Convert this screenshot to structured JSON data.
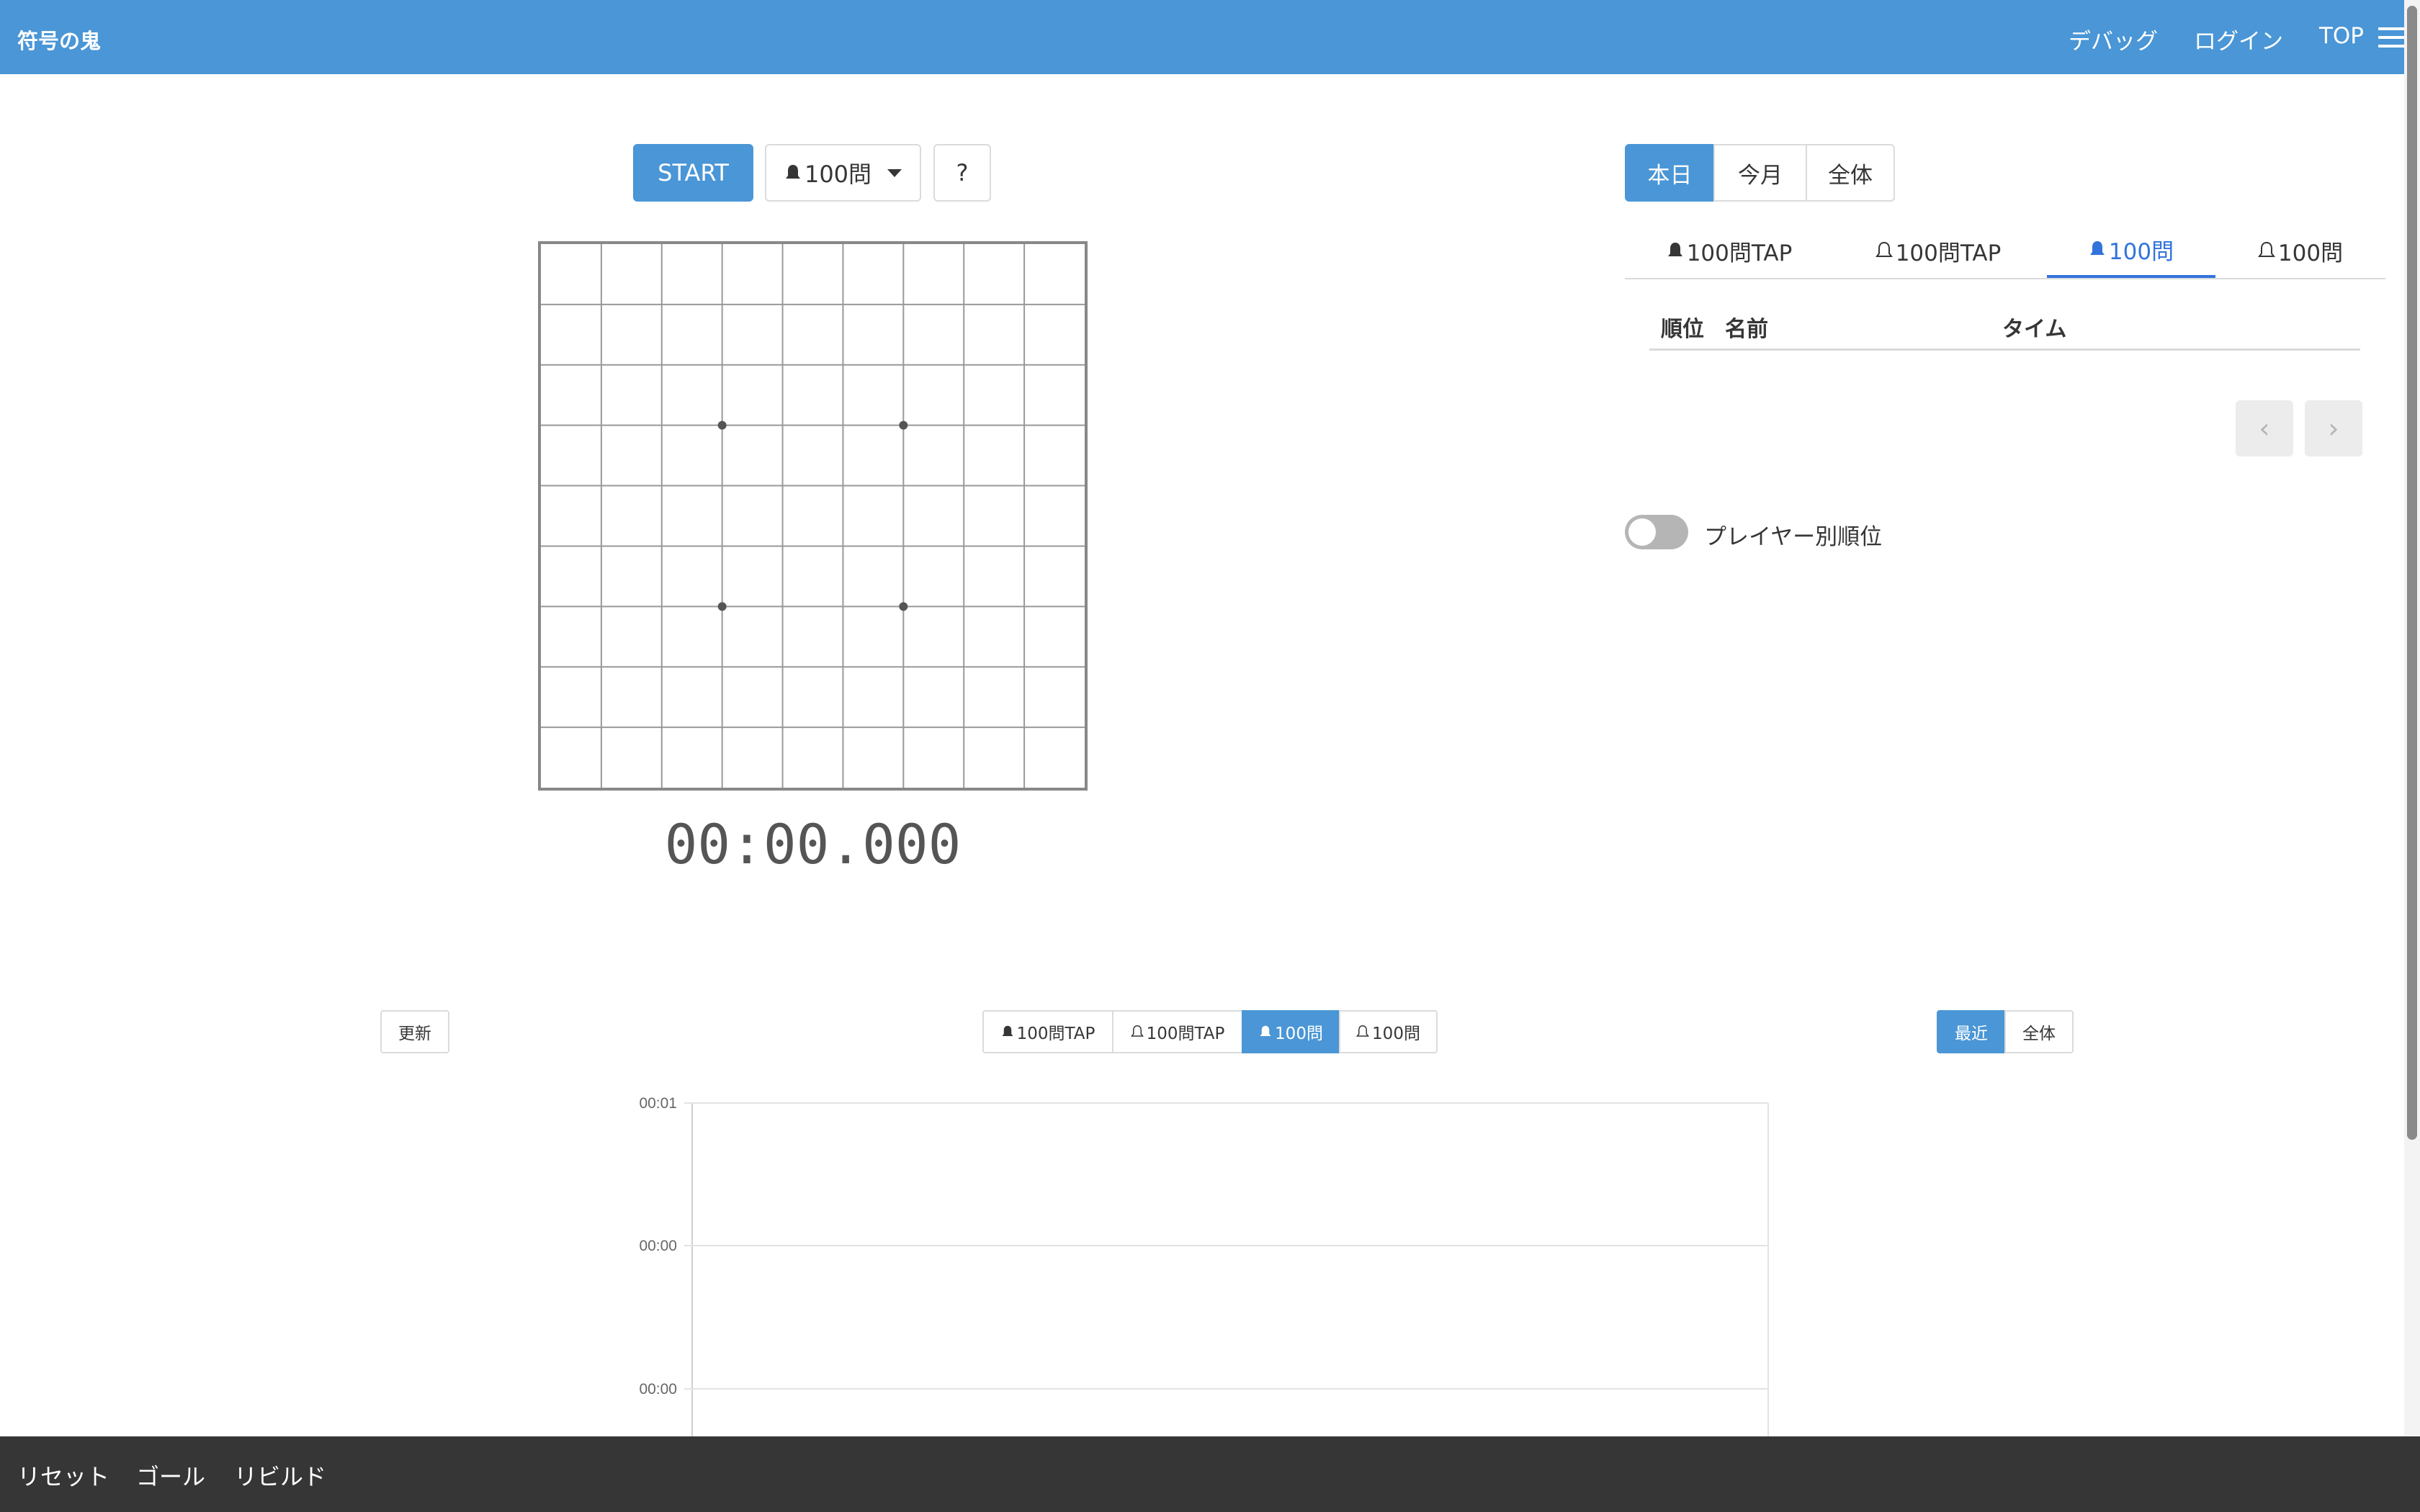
{
  "navbar": {
    "brand": "符号の鬼",
    "links": [
      "デバッグ",
      "ログイン",
      "TOP"
    ]
  },
  "controls": {
    "start_label": "START",
    "mode_label": "100問",
    "help_label": "?"
  },
  "board": {
    "rows": 9,
    "cols": 9,
    "star_points": [
      [
        3,
        3
      ],
      [
        3,
        6
      ],
      [
        6,
        3
      ],
      [
        6,
        6
      ]
    ]
  },
  "timer": "00:00.000",
  "ranking": {
    "periods": [
      "本日",
      "今月",
      "全体"
    ],
    "active_period": 0,
    "tabs": [
      "100問TAP",
      "100問TAP",
      "100問",
      "100問"
    ],
    "tab_bell": [
      "filled",
      "outline",
      "filled",
      "outline"
    ],
    "active_tab": 2,
    "columns": {
      "rank": "順位",
      "name": "名前",
      "time": "タイム"
    },
    "rows": [],
    "prev_icon": "‹",
    "next_icon": "›",
    "player_toggle_label": "プレイヤー別順位",
    "player_toggle_on": false
  },
  "history": {
    "refresh_label": "更新",
    "modes": [
      "100問TAP",
      "100問TAP",
      "100問",
      "100問"
    ],
    "mode_bell": [
      "filled",
      "outline",
      "filled",
      "outline"
    ],
    "active_mode": 2,
    "ranges": [
      "最近",
      "全体"
    ],
    "active_range": 0
  },
  "chart_data": {
    "type": "line",
    "x": [],
    "series": [],
    "yticks": [
      "00:01",
      "00:00",
      "00:00"
    ],
    "grid": true
  },
  "bottombar": {
    "items": [
      "リセット",
      "ゴール",
      "リビルド"
    ]
  },
  "colors": {
    "primary": "#4a96d6",
    "link_active": "#3273dc",
    "bottombar": "#363636"
  }
}
